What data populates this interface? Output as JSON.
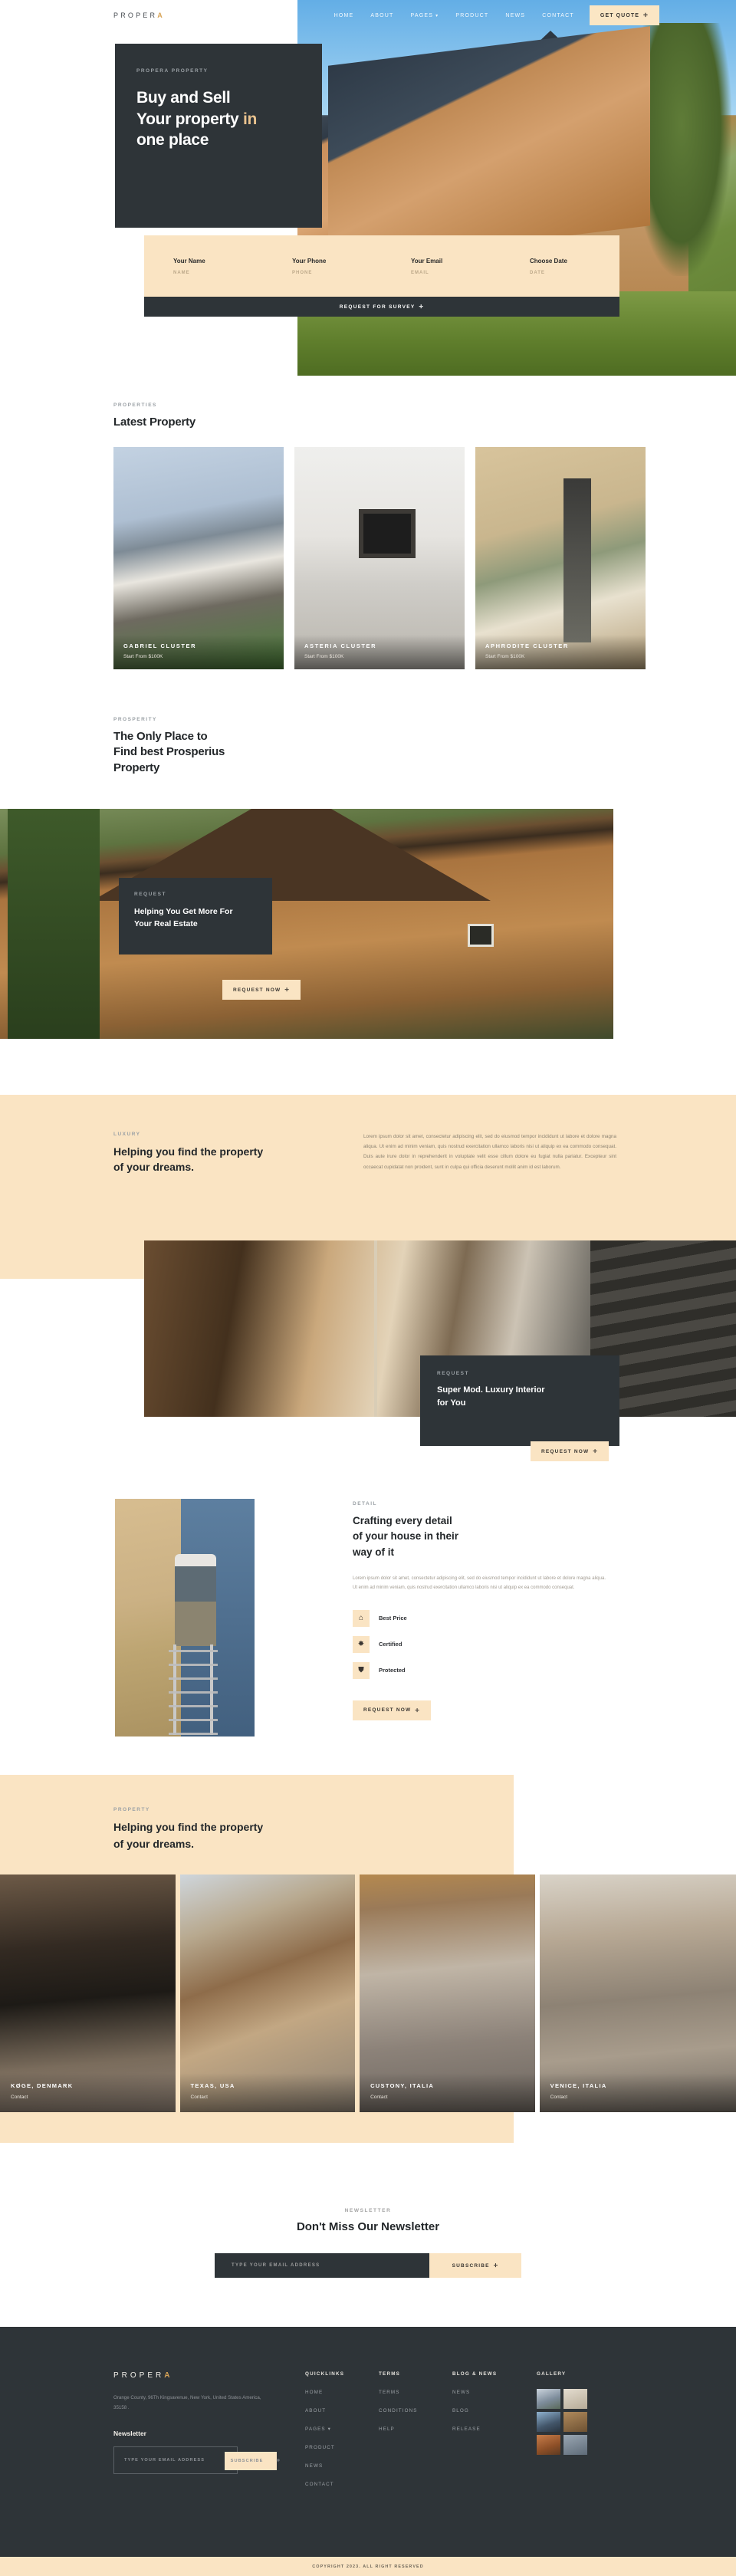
{
  "brand": {
    "name_plain": "PROPER",
    "name_accent": "A"
  },
  "nav": {
    "items": [
      {
        "label": "HOME"
      },
      {
        "label": "ABOUT"
      },
      {
        "label": "PAGES",
        "caret": "▾"
      },
      {
        "label": "PRODUCT"
      },
      {
        "label": "NEWS"
      },
      {
        "label": "CONTACT"
      }
    ],
    "cta": "GET QUOTE"
  },
  "hero": {
    "eyebrow": "PROPERA PROPERTY",
    "title_line1": "Buy and Sell",
    "title_line2": "Your property",
    "title_accent": "in",
    "title_line3": "one place",
    "form": {
      "fields": [
        {
          "label": "Your Name",
          "placeholder": "NAME"
        },
        {
          "label": "Your Phone",
          "placeholder": "PHONE"
        },
        {
          "label": "Your Email",
          "placeholder": "EMAIL"
        },
        {
          "label": "Choose Date",
          "placeholder": "DATE"
        }
      ],
      "submit": "REQUEST FOR SURVEY"
    }
  },
  "latest": {
    "eyebrow": "PROPERTIES",
    "title": "Latest Property",
    "cards": [
      {
        "name": "GABRIEL CLUSTER",
        "price": "Start From $100K"
      },
      {
        "name": "ASTERIA CLUSTER",
        "price": "Start From $100K"
      },
      {
        "name": "APHRODITE CLUSTER",
        "price": "Start From $100K"
      }
    ]
  },
  "prosperity": {
    "eyebrow": "PROSPERITY",
    "title_l1": "The Only Place to",
    "title_l2": "Find best Prosperius",
    "title_l3": "Property",
    "card": {
      "eyebrow": "REQUEST",
      "title_l1": "Helping You Get More For",
      "title_l2": "Your Real Estate",
      "button": "REQUEST NOW"
    }
  },
  "luxury": {
    "eyebrow": "LUXURY",
    "title_l1": "Helping you find the property",
    "title_l2": "of your dreams.",
    "paragraph": "Lorem ipsum dolor sit amet, consectetur adipiscing elit, sed do eiusmod tempor incididunt ut labore et dolore magna aliqua. Ut enim ad minim veniam, quis nostrud exercitation ullamco laboris nisi ut aliquip ex ea commodo consequat. Duis aute irure dolor in reprehenderit in voluptate velit esse cillum dolore eu fugiat nulla pariatur. Excepteur sint occaecat cupidatat non proident, sunt in culpa qui officia deserunt mollit anim id est laborum.",
    "card": {
      "eyebrow": "REQUEST",
      "title_l1": "Super Mod. Luxury Interior",
      "title_l2": "for You",
      "button": "REQUEST NOW"
    }
  },
  "craft": {
    "eyebrow": "DETAIL",
    "title_l1": "Crafting every detail",
    "title_l2": "of your house in their",
    "title_l3": "way of it",
    "paragraph": "Lorem ipsum dolor sit amet, consectetur adipiscing elit, sed do eiusmod tempor incididunt ut labore et dolore magna aliqua. Ut enim ad minim veniam, quis nostrud exercitation ullamco laboris nisi ut aliquip ex ea commodo consequat.",
    "features": [
      {
        "icon": "home-icon",
        "glyph": "⌂",
        "label": "Best Price"
      },
      {
        "icon": "certificate-icon",
        "glyph": "✸",
        "label": "Certified"
      },
      {
        "icon": "shield-icon",
        "glyph": "⛊",
        "label": "Protected"
      }
    ],
    "button": "REQUEST NOW"
  },
  "helping2": {
    "eyebrow": "PROPERTY",
    "title_l1": "Helping you find the property",
    "title_l2": "of your dreams."
  },
  "gallery": {
    "items": [
      {
        "name": "KØGE, DENMARK",
        "action": "Contact"
      },
      {
        "name": "TEXAS, USA",
        "action": "Contact"
      },
      {
        "name": "CUSTONY, ITALIA",
        "action": "Contact"
      },
      {
        "name": "VENICE, ITALIA",
        "action": "Contact"
      }
    ]
  },
  "newsletter": {
    "eyebrow": "NEWSLETTER",
    "title": "Don't Miss Our Newsletter",
    "placeholder": "TYPE YOUR EMAIL ADDRESS",
    "button": "SUBSCRIBE"
  },
  "footer": {
    "address": "Orange County, 96Th Kingsavenue, New York, United States America, 35158 .",
    "newsletter_title": "Newsletter",
    "newsletter_placeholder": "TYPE YOUR EMAIL ADDRESS",
    "newsletter_button": "SUBSCRIBE",
    "columns": [
      {
        "heading": "QUICKLINKS",
        "links": [
          "HOME",
          "ABOUT",
          "PAGES  ▾",
          "PRODUCT",
          "NEWS",
          "CONTACT"
        ]
      },
      {
        "heading": "TERMS",
        "links": [
          "TERMS",
          "CONDITIONS",
          "HELP"
        ]
      },
      {
        "heading": "BLOG & NEWS",
        "links": [
          "NEWS",
          "BLOG",
          "RELEASE"
        ]
      }
    ],
    "gallery_heading": "GALLERY",
    "copyright": "COPYRIGHT 2023. ALL RIGHT RESERVED"
  },
  "colors": {
    "dark": "#2e3438",
    "cream": "#fae4c3",
    "gold": "#d8a457"
  }
}
